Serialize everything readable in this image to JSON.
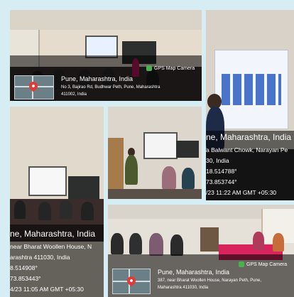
{
  "collage": {
    "photo1": {
      "title": "Pune, Maharashtra, India",
      "address_line1": "No 3, Bajirao Rd, Budhwar Peth, Pune, Maharashtra",
      "address_line2": "411002, India",
      "badge": "GPS Map Camera"
    },
    "photo2": {
      "title": "ne, Maharashtra, India",
      "line1": "a Balwant Chowk, Narayan Pe",
      "line2": "30, India",
      "line3": "18.514788°",
      "line4": "73.853744°",
      "line5": "/23 11:22 AM GMT +05:30"
    },
    "photo4": {
      "title": "ne, Maharashtra, India",
      "line1": "near Bharat Woollen House, N",
      "line2": "arashtra 411030, India",
      "line3": "8.514908°",
      "line4": "73.853443°",
      "line5": "4/23 11:05 AM GMT +05:30"
    },
    "photo5": {
      "title": "Pune, Maharashtra, India",
      "address_line1": "387, near Bharat Woollen House, Narayan Peth, Pune,",
      "address_line2": "Maharashtra 411030, India",
      "badge": "GPS Map Camera"
    }
  }
}
